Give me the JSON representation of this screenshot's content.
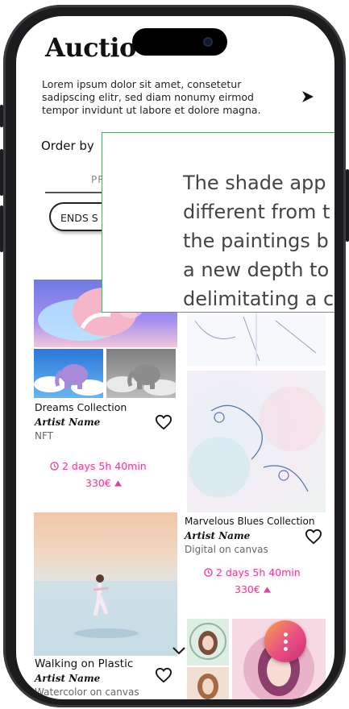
{
  "header": {
    "title": "Auctio",
    "intro": "Lorem ipsum dolor sit amet, consetetur sadipscing elitr, sed diam nonumy eirmod tempor invidunt ut labore et dolore magna."
  },
  "filters": {
    "order_by_label": "Order by",
    "tab_partial": "PR",
    "ends_pill": "ENDS S"
  },
  "tooltip": {
    "lines": [
      "The shade app",
      "different from t",
      "the paintings b",
      "a new depth to",
      "delimitating a c"
    ]
  },
  "items": [
    {
      "collection": "Dreams Collection",
      "artist": "Artist Name",
      "medium": "NFT",
      "timer": "2 days 5h 40min",
      "price": "330€"
    },
    {
      "collection": "Marvelous Blues Collection",
      "artist": "Artist Name",
      "medium": "Digital on canvas",
      "timer": "2 days 5h 40min",
      "price": "330€"
    },
    {
      "collection": "Walking on Plastic",
      "artist": "Artist Name",
      "medium": "Watercolor on canvas"
    }
  ],
  "colors": {
    "accent": "#e0449a",
    "tooltip_border": "#56a567",
    "fab_start": "#f6a24a",
    "fab_end": "#c73273"
  },
  "icons": {
    "heart": "heart-icon",
    "clock": "clock-icon",
    "bid": "triangle-up-icon",
    "chevron": "chevron-right-icon",
    "more": "more-vertical-icon"
  }
}
